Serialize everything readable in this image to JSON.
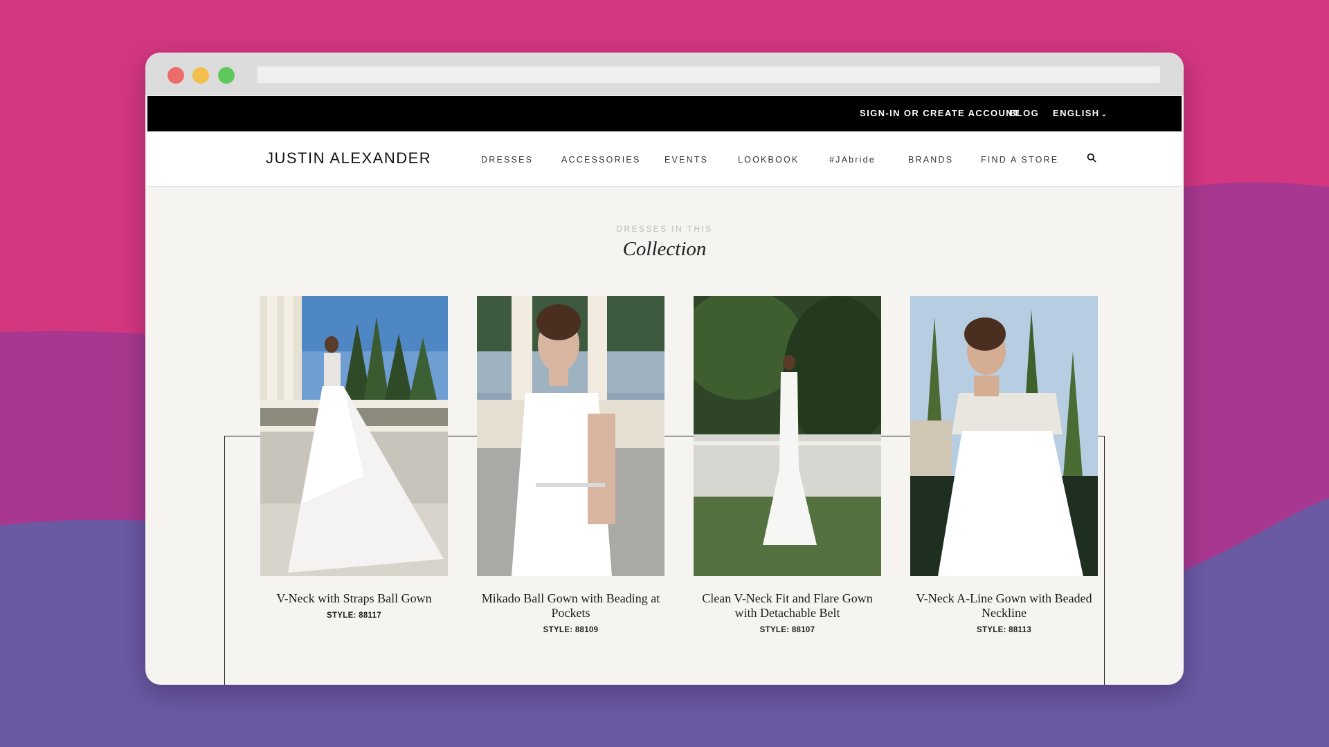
{
  "browser": {
    "url": ""
  },
  "topbar": {
    "signin_label": "SIGN-IN OR CREATE ACCOUNT",
    "blog_label": "BLOG",
    "language_label": "ENGLISH"
  },
  "nav": {
    "logo": "JUSTIN ALEXANDER",
    "items": [
      "DRESSES",
      "ACCESSORIES",
      "EVENTS",
      "LOOKBOOK",
      "#JAbride",
      "BRANDS",
      "FIND A STORE"
    ],
    "search_icon": "search-icon"
  },
  "section": {
    "eyebrow": "DRESSES IN THIS",
    "title": "Collection"
  },
  "dresses": [
    {
      "name": "V-Neck with Straps Ball Gown",
      "style": "STYLE: 88117"
    },
    {
      "name": "Mikado Ball Gown with Beading at Pockets",
      "style": "STYLE: 88109"
    },
    {
      "name": "Clean V-Neck Fit and Flare Gown with Detachable Belt",
      "style": "STYLE: 88107"
    },
    {
      "name": "V-Neck A-Line Gown with Beaded Neckline",
      "style": "STYLE: 88113"
    }
  ],
  "colors": {
    "background_top": "#d4377f",
    "background_bottom": "#6a5aa3",
    "page_bg": "#f6f4f1",
    "topbar_bg": "#000000"
  }
}
